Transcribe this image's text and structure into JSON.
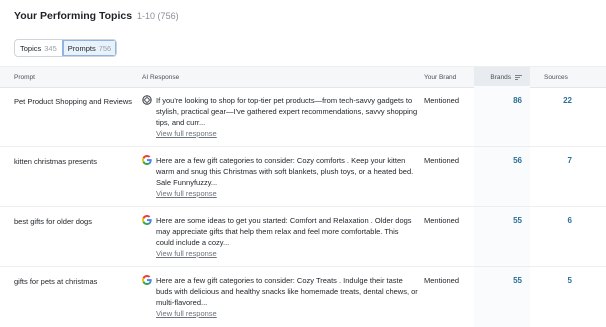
{
  "header": {
    "title": "Your Performing Topics",
    "range": "1-10 (756)"
  },
  "toggle": {
    "tabs": [
      {
        "label": "Topics",
        "count": "345"
      },
      {
        "label": "Prompts",
        "count": "756"
      }
    ],
    "active": "Prompts"
  },
  "columns": {
    "prompt": "Prompt",
    "ai_response": "AI Response",
    "your_brand": "Your Brand",
    "brands": "Brands",
    "sources": "Sources"
  },
  "rows": [
    {
      "prompt": "Pet Product Shopping and Reviews",
      "engine_icon": "openai-icon",
      "response": "If you're looking to shop for top-tier pet products—from tech-savvy gadgets to stylish, practical gear—I've gathered expert recommendations, savvy shopping tips, and curr...",
      "link": "View full response",
      "brand": "Mentioned",
      "brands": "86",
      "sources": "22"
    },
    {
      "prompt": "kitten christmas presents",
      "engine_icon": "google-icon",
      "response": "Here are a few gift categories to consider: Cozy comforts . Keep your kitten warm and snug this Christmas with soft blankets, plush toys, or a heated bed. Sale Funnyfuzzy...",
      "link": "View full response",
      "brand": "Mentioned",
      "brands": "56",
      "sources": "7"
    },
    {
      "prompt": "best gifts for older dogs",
      "engine_icon": "google-icon",
      "response": "Here are some ideas to get you started: Comfort and Relaxation . Older dogs may appreciate gifts that help them relax and feel more comfortable. This could include a cozy...",
      "link": "View full response",
      "brand": "Mentioned",
      "brands": "55",
      "sources": "6"
    },
    {
      "prompt": "gifts for pets at christmas",
      "engine_icon": "google-icon",
      "response": "Here are a few gift categories to consider: Cozy Treats . Indulge their taste buds with delicious and healthy snacks like homemade treats, dental chews, or multi-flavored...",
      "link": "View full response",
      "brand": "Mentioned",
      "brands": "55",
      "sources": "5"
    }
  ],
  "colors": {
    "accent": "#2a6f97",
    "active_tab_bg": "#e9f1fb",
    "header_bg": "#f6f7f8"
  }
}
